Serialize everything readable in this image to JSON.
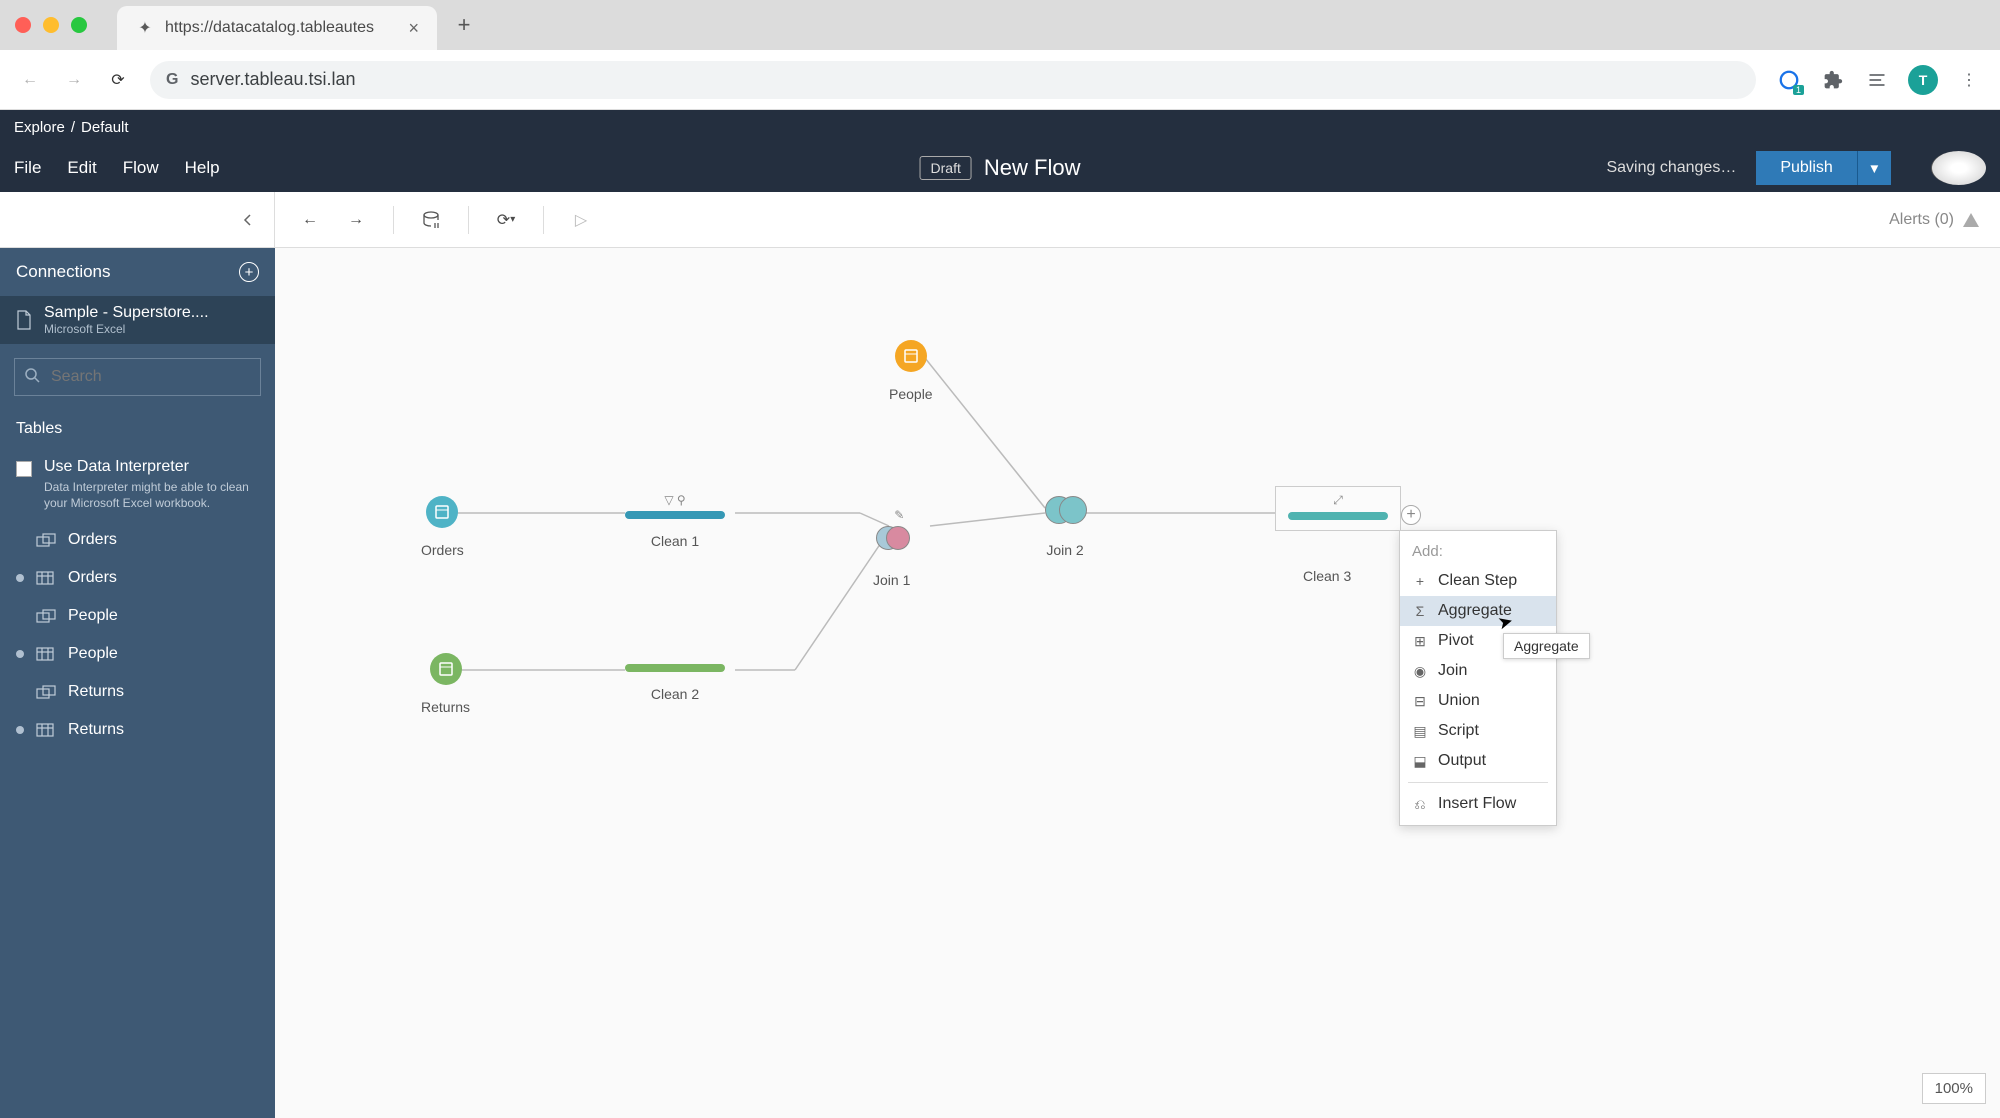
{
  "browser": {
    "tab_title": "https://datacatalog.tableautes",
    "url": "server.tableau.tsi.lan",
    "profile_initial": "T"
  },
  "header": {
    "breadcrumb": {
      "explore": "Explore",
      "sep": " / ",
      "project": "Default"
    },
    "menu": {
      "file": "File",
      "edit": "Edit",
      "flow": "Flow",
      "help": "Help"
    },
    "draft_label": "Draft",
    "flow_title": "New Flow",
    "saving": "Saving changes…",
    "publish": "Publish"
  },
  "sidebar": {
    "connections_label": "Connections",
    "connection": {
      "name": "Sample - Superstore....",
      "type": "Microsoft Excel"
    },
    "search_placeholder": "Search",
    "tables_label": "Tables",
    "data_interpreter": {
      "label": "Use Data Interpreter",
      "hint": "Data Interpreter might be able to clean your Microsoft Excel workbook."
    },
    "tables": [
      {
        "name": "Orders",
        "linked": true
      },
      {
        "name": "Orders",
        "linked": false,
        "dot": true
      },
      {
        "name": "People",
        "linked": true
      },
      {
        "name": "People",
        "linked": false,
        "dot": true
      },
      {
        "name": "Returns",
        "linked": true
      },
      {
        "name": "Returns",
        "linked": false,
        "dot": true
      }
    ]
  },
  "toolbar": {
    "alerts": "Alerts (0)"
  },
  "canvas": {
    "nodes": {
      "orders": "Orders",
      "returns": "Returns",
      "people": "People",
      "clean1": "Clean 1",
      "clean2": "Clean 2",
      "join1": "Join 1",
      "join2": "Join 2",
      "clean3": "Clean 3"
    },
    "zoom": "100%"
  },
  "context_menu": {
    "header": "Add:",
    "items": {
      "clean_step": "Clean Step",
      "aggregate": "Aggregate",
      "pivot": "Pivot",
      "join": "Join",
      "union": "Union",
      "script": "Script",
      "output": "Output",
      "insert_flow": "Insert Flow"
    },
    "tooltip": "Aggregate"
  }
}
